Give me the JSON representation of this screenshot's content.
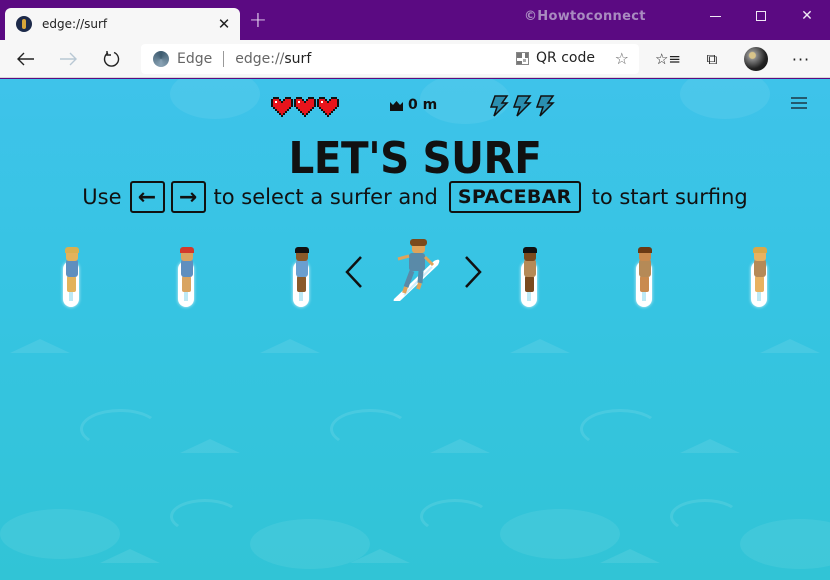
{
  "browser": {
    "tab": {
      "title": "edge://surf",
      "close_label": "✕"
    },
    "new_tab_label": "+",
    "watermark": "©Howtoconnect",
    "window_controls": {
      "minimize": "minimize",
      "maximize": "maximize",
      "close": "✕"
    },
    "address_bar": {
      "site_label": "Edge",
      "url_prefix": "edge://",
      "url_path": "surf"
    },
    "qr_label": "QR code",
    "favorite_star": "☆",
    "favorites_icon": "☆≡",
    "collections_icon": "⧉",
    "more_label": "···"
  },
  "game": {
    "hud": {
      "lives": 3,
      "distance": "0 m",
      "boosts": 3
    },
    "title": "LET'S SURF",
    "instructions": {
      "use": "Use",
      "left_key": "←",
      "right_key": "→",
      "select_text": "to select a surfer and",
      "space_key": "SPACEBAR",
      "start_text": "to start surfing"
    },
    "selector": {
      "prev_label": "‹",
      "next_label": "›"
    },
    "surfers": [
      {
        "name": "surfer-1",
        "skin": "#e3b35b",
        "hair": "#d9b050",
        "suit": "#5f8fbf"
      },
      {
        "name": "surfer-2",
        "skin": "#d9a461",
        "hair": "#d23a2c",
        "suit": "#5f8fbf"
      },
      {
        "name": "surfer-3",
        "skin": "#8a5a2a",
        "hair": "#111111",
        "suit": "#6a9fd0"
      },
      {
        "name": "surfer-selected",
        "skin": "#e0a45a",
        "hair": "#7a4a1c",
        "suit": "#5a8aa8"
      },
      {
        "name": "surfer-5",
        "skin": "#7a4a1e",
        "hair": "#111111",
        "suit": "#b58a57"
      },
      {
        "name": "surfer-6",
        "skin": "#c98a4e",
        "hair": "#6a3a14",
        "suit": "#b58a57"
      },
      {
        "name": "surfer-7",
        "skin": "#e8b260",
        "hair": "#d8a84a",
        "suit": "#b58a57"
      }
    ],
    "colors": {
      "heart": "#e8141c",
      "bolt": "#2a8fb0",
      "water_top": "#3ec3ea",
      "water_bottom": "#31c4d6",
      "titlebar": "#5b0a82"
    }
  }
}
